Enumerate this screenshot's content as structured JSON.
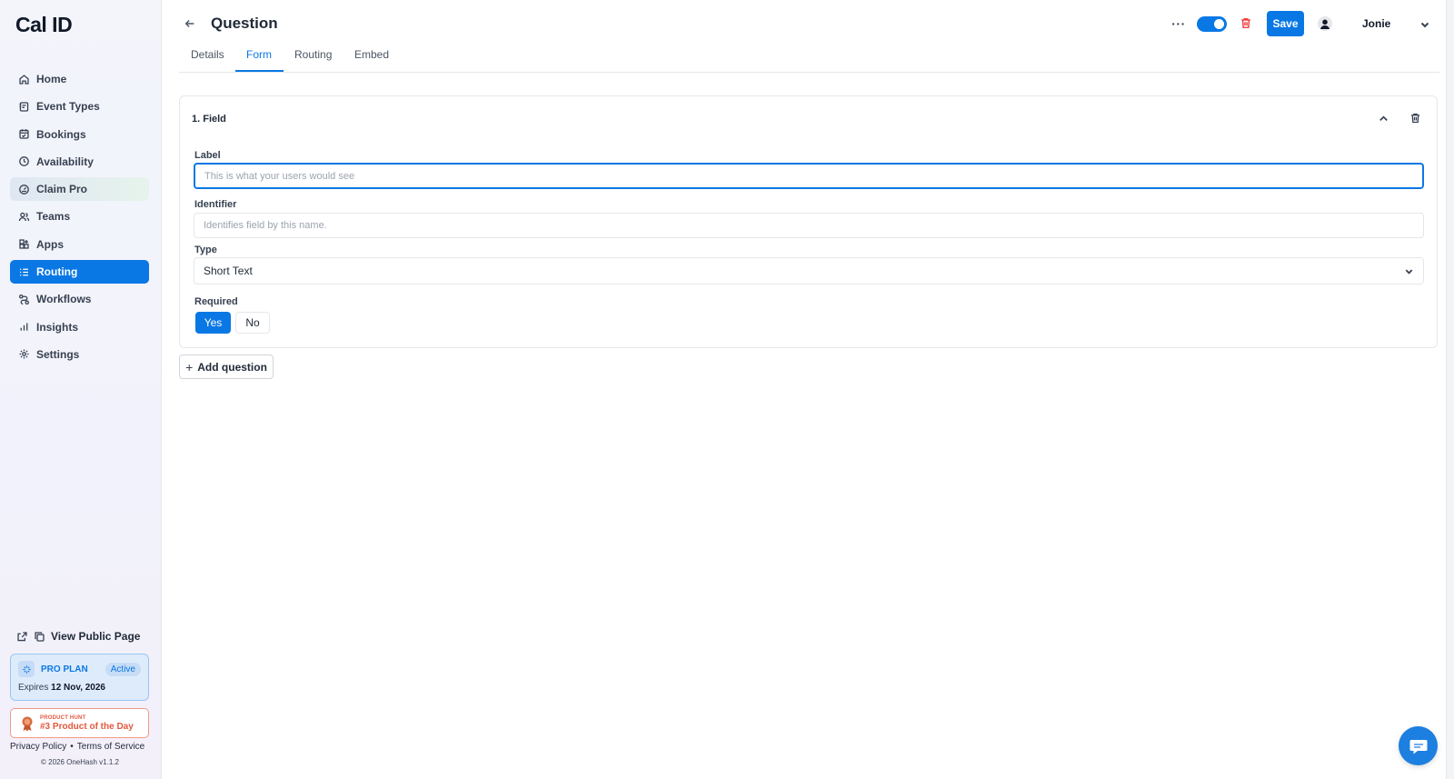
{
  "app": {
    "logo": "Cal ID"
  },
  "sidebar": {
    "items": [
      {
        "label": "Home",
        "icon": "home-icon"
      },
      {
        "label": "Event Types",
        "icon": "event-types-icon"
      },
      {
        "label": "Bookings",
        "icon": "calendar-icon"
      },
      {
        "label": "Availability",
        "icon": "clock-icon"
      },
      {
        "label": "Claim Pro",
        "icon": "gauge-icon"
      },
      {
        "label": "Teams",
        "icon": "users-icon"
      },
      {
        "label": "Apps",
        "icon": "apps-icon"
      },
      {
        "label": "Routing",
        "icon": "routing-icon",
        "active": true
      },
      {
        "label": "Workflows",
        "icon": "workflows-icon"
      },
      {
        "label": "Insights",
        "icon": "bar-chart-icon"
      },
      {
        "label": "Settings",
        "icon": "gear-icon"
      }
    ],
    "public_page": "View Public Page",
    "plan": {
      "name": "PRO PLAN",
      "status": "Active",
      "expires_label": "Expires",
      "expires_date": "12 Nov, 2026"
    },
    "product_hunt": {
      "small": "PRODUCT HUNT",
      "big": "#3 Product of the Day"
    },
    "footer": {
      "privacy": "Privacy Policy",
      "separator": "•",
      "terms": "Terms of Service",
      "copyright": "© 2026 OneHash v1.1.2"
    }
  },
  "header": {
    "title": "Question",
    "save_label": "Save",
    "more_label": "···",
    "user_name": "Jonie",
    "toggle_on": true
  },
  "tabs": [
    {
      "label": "Details"
    },
    {
      "label": "Form",
      "active": true
    },
    {
      "label": "Routing"
    },
    {
      "label": "Embed"
    }
  ],
  "form": {
    "card_title": "1. Field",
    "label_field": {
      "label": "Label",
      "value": "",
      "placeholder": "This is what your users would see"
    },
    "identifier_field": {
      "label": "Identifier",
      "value": "",
      "placeholder": "Identifies field by this name."
    },
    "type_field": {
      "label": "Type",
      "value": "Short Text"
    },
    "required_field": {
      "label": "Required",
      "yes": "Yes",
      "no": "No",
      "selected": "Yes"
    },
    "add_question": "Add question"
  },
  "colors": {
    "accent": "#0a78e4",
    "danger": "#ef4444",
    "product_hunt": "#e4583e"
  }
}
